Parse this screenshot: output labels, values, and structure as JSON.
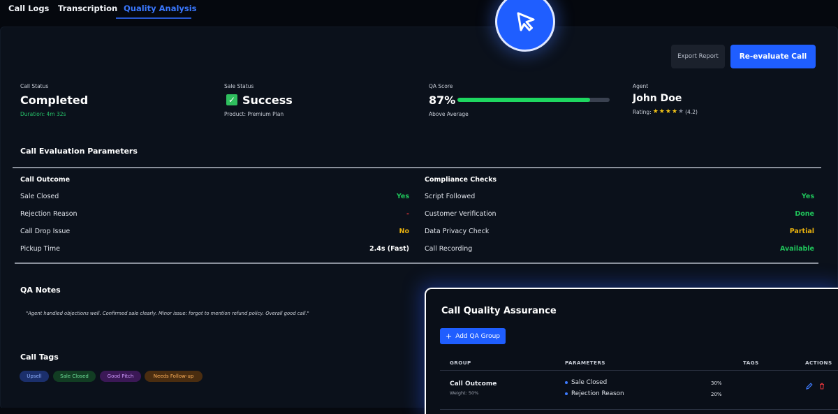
{
  "nav": {
    "tabs": [
      {
        "label": "Call Logs"
      },
      {
        "label": "Transcription"
      },
      {
        "label": "Quality Analysis"
      }
    ]
  },
  "actions": {
    "export_label": "Export Report",
    "reevaluate_label": "Re-evaluate Call"
  },
  "stats": {
    "call_status": {
      "label": "Call Status",
      "value": "Completed",
      "sub": "Duration: 4m 32s"
    },
    "sale_status": {
      "label": "Sale Status",
      "value": "Success",
      "sub": "Product: Premium Plan"
    },
    "qa_score": {
      "label": "QA Score",
      "value": "87%",
      "sub": "Above Average",
      "progress": 0.87
    },
    "agent": {
      "label": "Agent",
      "value": "John Doe",
      "rating_prefix": "Rating:",
      "rating": 4,
      "rating_max": 5,
      "rating_text": "(4.2)"
    }
  },
  "evaluation": {
    "title": "Call Evaluation Parameters",
    "call_outcome": {
      "title": "Call Outcome",
      "rows": [
        {
          "label": "Sale Closed",
          "value": "Yes",
          "status": "green"
        },
        {
          "label": "Rejection Reason",
          "value": "-",
          "status": "red"
        },
        {
          "label": "Call Drop Issue",
          "value": "No",
          "status": "yellow"
        },
        {
          "label": "Pickup Time",
          "value": "2.4s (Fast)",
          "status": "white"
        }
      ]
    },
    "compliance": {
      "title": "Compliance Checks",
      "rows": [
        {
          "label": "Script Followed",
          "value": "Yes",
          "status": "green"
        },
        {
          "label": "Customer Verification",
          "value": "Done",
          "status": "green"
        },
        {
          "label": "Data Privacy Check",
          "value": "Partial",
          "status": "yellow"
        },
        {
          "label": "Call Recording",
          "value": "Available",
          "status": "green"
        }
      ]
    }
  },
  "qa_notes": {
    "title": "QA Notes",
    "text": "\"Agent handled objections well. Confirmed sale clearly. Minor issue: forgot to mention refund policy. Overall good call.\""
  },
  "call_tags": {
    "title": "Call Tags",
    "items": [
      {
        "label": "Upsell",
        "color": "#8fb0ff"
      },
      {
        "label": "Sale Closed",
        "color": "#6fe39a"
      },
      {
        "label": "Good Pitch",
        "color": "#d09bff"
      },
      {
        "label": "Needs Follow-up",
        "color": "#ffb15a"
      }
    ]
  },
  "qa_card": {
    "title": "Call Quality Assurance",
    "add_label": "Add QA Group",
    "columns": [
      "GROUP",
      "PARAMETERS",
      "TAGS",
      "ACTIONS"
    ],
    "rows": [
      {
        "group": "Call Outcome",
        "weight": "Weight: 50%",
        "params": [
          {
            "name": "Sale Closed",
            "pct": "30%"
          },
          {
            "name": "Rejection Reason",
            "pct": "20%"
          }
        ]
      }
    ]
  },
  "icons": {
    "cursor": "cursor-arrow-icon",
    "check": "check-icon",
    "plus": "plus-icon",
    "edit": "pencil-icon",
    "delete": "trash-icon",
    "star": "star-icon"
  },
  "colors": {
    "accent": "#1f5eff",
    "success": "#1fc35a",
    "warning": "#e8b10e",
    "danger": "#e0343a",
    "background": "#0b111b"
  }
}
